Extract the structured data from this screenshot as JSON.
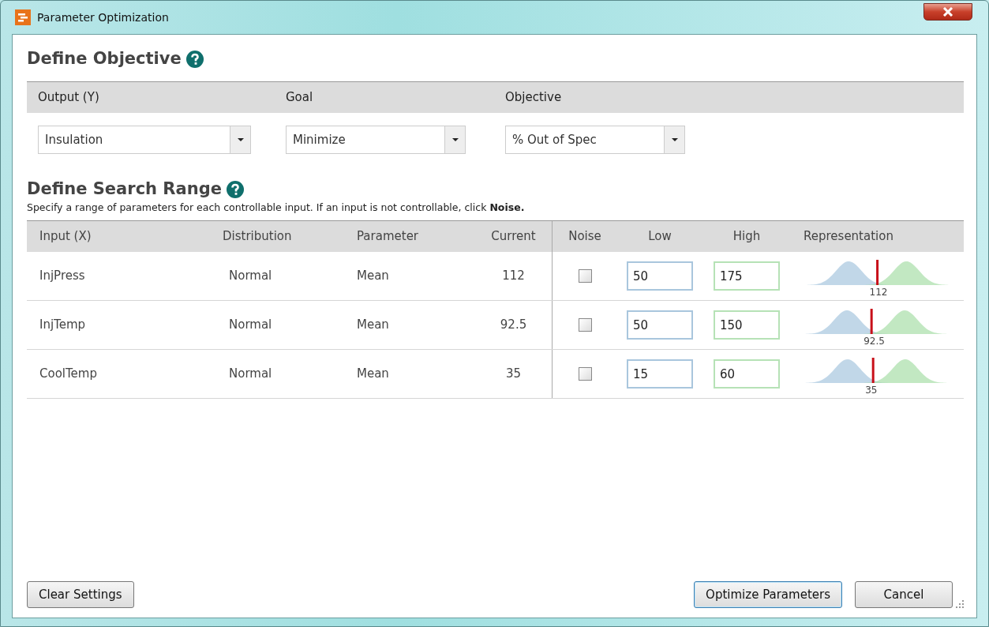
{
  "window": {
    "title": "Parameter Optimization"
  },
  "objective": {
    "heading": "Define Objective",
    "columns": [
      "Output (Y)",
      "Goal",
      "Objective"
    ],
    "dropdowns": [
      {
        "value": "Insulation"
      },
      {
        "value": "Minimize"
      },
      {
        "value": "% Out of Spec"
      }
    ]
  },
  "search_range": {
    "heading": "Define Search Range",
    "description": "Specify a range of parameters for each controllable input. If an input is not controllable, click **Noise.**",
    "columns": [
      "Input (X)",
      "Distribution",
      "Parameter",
      "Current",
      "Noise",
      "Low",
      "High",
      "Representation"
    ],
    "rows": [
      {
        "input": "InjPress",
        "distribution": "Normal",
        "parameter": "Mean",
        "current": "112",
        "noise": false,
        "low": "50",
        "high": "175",
        "marker_label": "112"
      },
      {
        "input": "InjTemp",
        "distribution": "Normal",
        "parameter": "Mean",
        "current": "92.5",
        "noise": false,
        "low": "50",
        "high": "150",
        "marker_label": "92.5"
      },
      {
        "input": "CoolTemp",
        "distribution": "Normal",
        "parameter": "Mean",
        "current": "35",
        "noise": false,
        "low": "15",
        "high": "60",
        "marker_label": "35"
      }
    ]
  },
  "buttons": {
    "left": "Clear Settings",
    "primary": "Optimize Parameters",
    "cancel": "Cancel"
  }
}
